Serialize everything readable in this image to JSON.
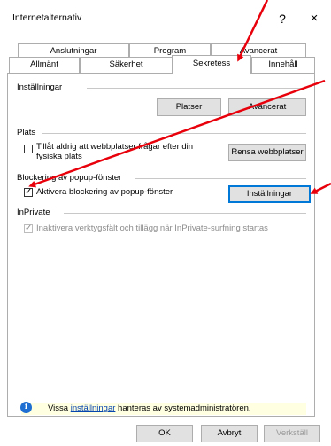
{
  "window": {
    "title": "Internetalternativ",
    "help": "?",
    "close": "×"
  },
  "tabs": {
    "row1": [
      "Anslutningar",
      "Program",
      "Avancerat"
    ],
    "row2": [
      "Allmänt",
      "Säkerhet",
      "Sekretess",
      "Innehåll"
    ],
    "active": "Sekretess"
  },
  "settings": {
    "heading": "Inställningar",
    "sites_button": "Platser",
    "advanced_button": "Avancerat"
  },
  "location": {
    "heading": "Plats",
    "checkbox_line1": "Tillåt aldrig att webbplatser frågar efter din",
    "checkbox_line2": "fysiska plats",
    "checkbox_checked": false,
    "clear_button": "Rensa webbplatser"
  },
  "popup": {
    "heading": "Blockering av popup-fönster",
    "checkbox_label": "Aktivera blockering av popup-fönster",
    "checkbox_checked": true,
    "settings_button": "Inställningar"
  },
  "inprivate": {
    "heading": "InPrivate",
    "checkbox_label": "Inaktivera verktygsfält och tillägg när InPrivate-surfning startas",
    "checkbox_checked": true,
    "disabled": true
  },
  "infobar": {
    "prefix": "Vissa ",
    "link": "inställningar",
    "suffix": " hanteras av systemadministratören."
  },
  "footer": {
    "ok": "OK",
    "cancel": "Avbryt",
    "apply": "Verkställ"
  },
  "colors": {
    "arrow": "#e8000b",
    "focus": "#0078d7",
    "infobar": "#ffffe1"
  }
}
